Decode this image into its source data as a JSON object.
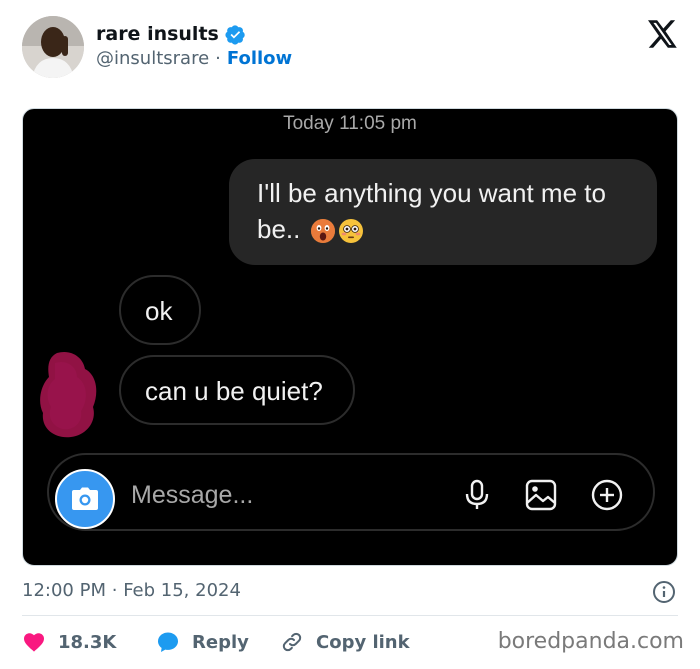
{
  "author": {
    "name": "rare insults",
    "handle": "@insultsrare",
    "separator": "·",
    "follow_label": "Follow",
    "verified": true
  },
  "media": {
    "chat": {
      "timestamp": "Today 11:05 pm",
      "messages": [
        {
          "direction": "outgoing",
          "text": "I'll be anything you want me to be..",
          "emojis": [
            "face-screaming-emoji",
            "flushed-face-emoji"
          ]
        },
        {
          "direction": "incoming",
          "text": "ok"
        },
        {
          "direction": "incoming",
          "text": "can u be quiet?"
        }
      ],
      "composer": {
        "placeholder": "Message...",
        "icons": [
          "camera-icon",
          "microphone-icon",
          "image-icon",
          "plus-circle-icon"
        ]
      }
    }
  },
  "post": {
    "time": "12:00 PM",
    "separator": "·",
    "date": "Feb 15, 2024"
  },
  "actions": {
    "likes_count": "18.3K",
    "reply_label": "Reply",
    "copy_label": "Copy link"
  },
  "watermark": "boredpanda.com",
  "colors": {
    "accent": "#0074d4",
    "like": "#f91880",
    "reply": "#1d9bf0",
    "verified": "#1d9bf0",
    "chat_bg": "#000000",
    "bubble_out": "#262626",
    "camera_button": "#3797f0"
  }
}
